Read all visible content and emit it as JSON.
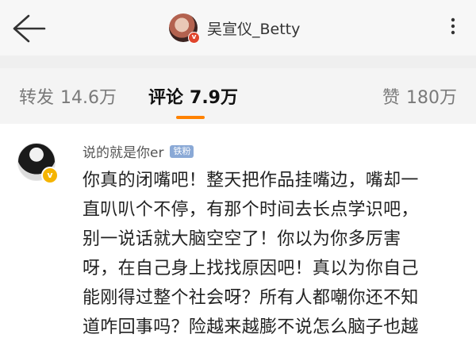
{
  "header": {
    "user_name": "吴宣仪_Betty",
    "avatar_badge": "v"
  },
  "tabs": [
    {
      "label": "转发",
      "count": "14.6万"
    },
    {
      "label": "评论",
      "count": "7.9万"
    },
    {
      "label": "赞",
      "count": "180万"
    }
  ],
  "colors": {
    "accent": "#ff8200",
    "badge_blue": "#8aa9d6",
    "vip_gold": "#f5b400"
  },
  "comment": {
    "user_name": "说的就是你er",
    "badge": "铁粉",
    "vip_mark": "v",
    "lines": [
      "你真的闭嘴吧！整天把作品挂嘴边，嘴却一",
      "直叭叭个不停，有那个时间去长点学识吧，",
      "别一说话就大脑空空了！你以为你多厉害",
      "呀，在自己身上找找原因吧！真以为你自己",
      "能刚得过整个社会呀？所有人都嘲你还不知",
      "道咋回事吗？险越来越膨不说怎么脑子也越"
    ]
  }
}
